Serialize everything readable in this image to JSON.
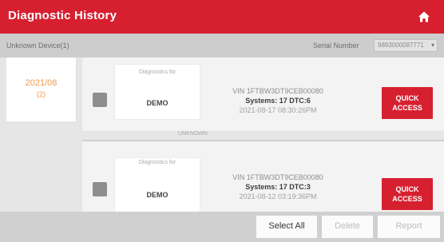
{
  "header": {
    "title": "Diagnostic History",
    "home_icon": "home-icon",
    "color": "#d62030"
  },
  "filter": {
    "left_label": "Unknown Device(1)",
    "serial_label": "Serial Number",
    "serial_value": "9893000087771"
  },
  "date_group": {
    "date": "2021/08",
    "count": "(2)",
    "accent_color": "#f2974a"
  },
  "records": [
    {
      "card_label": "Diagnostics for",
      "card_value": "DEMO",
      "vin": "VIN 1FTBW3DT9CEB00080",
      "systems": "Systems: 17 DTC:6",
      "time": "2021-08-17 08:30:26PM",
      "button": "QUICK ACCESS",
      "sub_label": "UNKNOWN"
    },
    {
      "card_label": "Diagnostics for",
      "card_value": "DEMO",
      "vin": "VIN 1FTBW3DT9CEB00080",
      "systems": "Systems: 17 DTC:3",
      "time": "2021-08-12 03:19:36PM",
      "button": "QUICK ACCESS"
    }
  ],
  "footer": {
    "select_all": "Select All",
    "delete": "Delete",
    "report": "Report"
  }
}
